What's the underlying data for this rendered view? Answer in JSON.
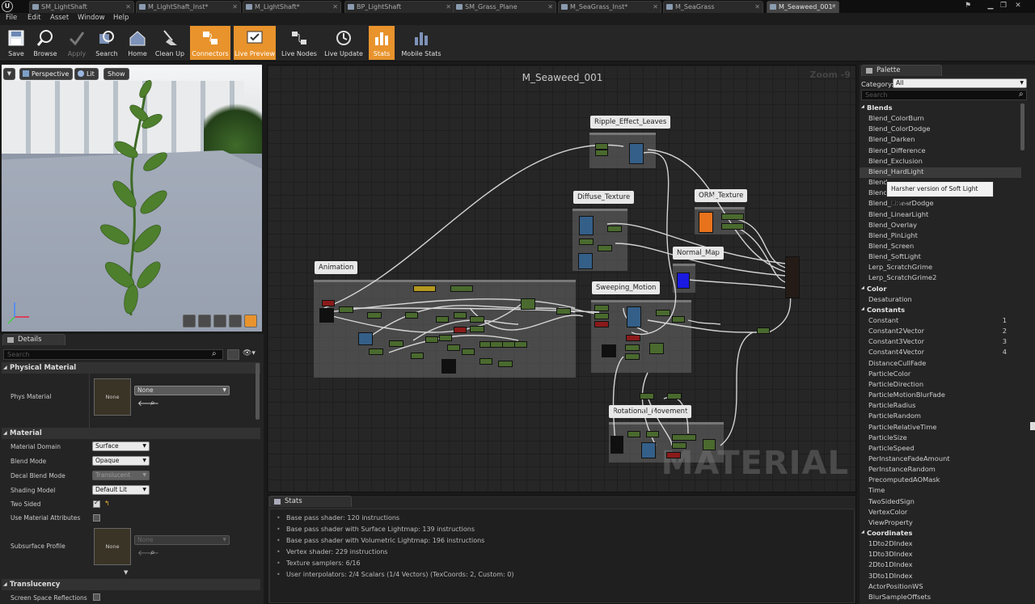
{
  "tabs": [
    {
      "label": "SM_LightShaft",
      "active": false
    },
    {
      "label": "M_LightShaft_Inst*",
      "active": false
    },
    {
      "label": "M_LightShaft*",
      "active": false
    },
    {
      "label": "BP_LightShaft",
      "active": false
    },
    {
      "label": "SM_Grass_Plane",
      "active": false
    },
    {
      "label": "M_SeaGrass_Inst*",
      "active": false
    },
    {
      "label": "M_SeaGrass",
      "active": false
    },
    {
      "label": "M_Seaweed_001*",
      "active": true
    }
  ],
  "menu": [
    "File",
    "Edit",
    "Asset",
    "Window",
    "Help"
  ],
  "toolbar": [
    {
      "label": "Save",
      "state": "normal",
      "icon": "save-icon"
    },
    {
      "label": "Browse",
      "state": "normal",
      "icon": "browse-icon"
    },
    {
      "label": "Apply",
      "state": "disabled",
      "icon": "apply-icon"
    },
    {
      "label": "Search",
      "state": "normal",
      "icon": "search-icon"
    },
    {
      "label": "Home",
      "state": "normal",
      "icon": "home-icon"
    },
    {
      "label": "Clean Up",
      "state": "normal",
      "icon": "clean-up-icon"
    },
    {
      "label": "Connectors",
      "state": "active",
      "icon": "connectors-icon"
    },
    {
      "label": "Live Preview",
      "state": "active",
      "icon": "live-preview-icon"
    },
    {
      "label": "Live Nodes",
      "state": "normal",
      "icon": "live-nodes-icon"
    },
    {
      "label": "Live Update",
      "state": "normal",
      "icon": "live-update-icon"
    },
    {
      "label": "Stats",
      "state": "active",
      "icon": "stats-icon"
    },
    {
      "label": "Mobile Stats",
      "state": "normal",
      "icon": "mobile-stats-icon"
    }
  ],
  "viewport": {
    "perspective": "Perspective",
    "lit": "Lit",
    "show": "Show"
  },
  "details": {
    "tab": "Details",
    "search_placeholder": "Search",
    "physical_material": {
      "header": "Physical Material",
      "phys_material_label": "Phys Material",
      "thumb_text": "None",
      "value": "None"
    },
    "material": {
      "header": "Material",
      "rows": [
        {
          "label": "Material Domain",
          "value": "Surface",
          "enabled": true
        },
        {
          "label": "Blend Mode",
          "value": "Opaque",
          "enabled": true
        },
        {
          "label": "Decal Blend Mode",
          "value": "Translucent",
          "enabled": false
        },
        {
          "label": "Shading Model",
          "value": "Default Lit",
          "enabled": true
        }
      ],
      "two_sided_label": "Two Sided",
      "two_sided": true,
      "use_attr_label": "Use Material Attributes",
      "use_attr": false,
      "subsurface_label": "Subsurface Profile",
      "subsurface_thumb": "None",
      "subsurface_value": "None"
    },
    "translucency": {
      "header": "Translucency",
      "ssr_label": "Screen Space Reflections"
    }
  },
  "graph": {
    "title": "M_Seaweed_001",
    "zoom": "Zoom -9",
    "watermark": "MATERIAL",
    "comments": [
      {
        "name": "Ripple_Effect_Leaves"
      },
      {
        "name": "Diffuse_Texture"
      },
      {
        "name": "ORM_Texture"
      },
      {
        "name": "Normal_Map"
      },
      {
        "name": "Animation"
      },
      {
        "name": "Sweeping_Motion"
      },
      {
        "name": "Rotational_Movement"
      }
    ]
  },
  "stats": {
    "tab": "Stats",
    "lines": [
      "Base pass shader: 120 instructions",
      "Base pass shader with Surface Lightmap: 139 instructions",
      "Base pass shader with Volumetric Lightmap: 196 instructions",
      "Vertex shader: 229 instructions",
      "Texture samplers: 6/16",
      "User interpolators: 2/4 Scalars (1/4 Vectors) (TexCoords: 2, Custom: 0)"
    ]
  },
  "palette": {
    "tab": "Palette",
    "category_label": "Category:",
    "category_value": "All",
    "search_placeholder": "Search",
    "tooltip": "Harsher version of Soft Light blend",
    "entries": [
      {
        "t": "cat",
        "label": "Blends"
      },
      {
        "t": "item",
        "label": "Blend_ColorBurn"
      },
      {
        "t": "item",
        "label": "Blend_ColorDodge"
      },
      {
        "t": "item",
        "label": "Blend_Darken"
      },
      {
        "t": "item",
        "label": "Blend_Difference"
      },
      {
        "t": "item",
        "label": "Blend_Exclusion"
      },
      {
        "t": "item",
        "label": "Blend_HardLight",
        "hover": true
      },
      {
        "t": "item",
        "label": "Blend"
      },
      {
        "t": "item",
        "label": "Blend"
      },
      {
        "t": "item",
        "label": "Blend_LinearDodge"
      },
      {
        "t": "item",
        "label": "Blend_LinearLight"
      },
      {
        "t": "item",
        "label": "Blend_Overlay"
      },
      {
        "t": "item",
        "label": "Blend_PinLight"
      },
      {
        "t": "item",
        "label": "Blend_Screen"
      },
      {
        "t": "item",
        "label": "Blend_SoftLight"
      },
      {
        "t": "item",
        "label": "Lerp_ScratchGrime"
      },
      {
        "t": "item",
        "label": "Lerp_ScratchGrime2"
      },
      {
        "t": "cat",
        "label": "Color"
      },
      {
        "t": "item",
        "label": "Desaturation"
      },
      {
        "t": "cat",
        "label": "Constants"
      },
      {
        "t": "item",
        "label": "Constant",
        "key": "1"
      },
      {
        "t": "item",
        "label": "Constant2Vector",
        "key": "2"
      },
      {
        "t": "item",
        "label": "Constant3Vector",
        "key": "3"
      },
      {
        "t": "item",
        "label": "Constant4Vector",
        "key": "4"
      },
      {
        "t": "item",
        "label": "DistanceCullFade"
      },
      {
        "t": "item",
        "label": "ParticleColor"
      },
      {
        "t": "item",
        "label": "ParticleDirection"
      },
      {
        "t": "item",
        "label": "ParticleMotionBlurFade"
      },
      {
        "t": "item",
        "label": "ParticleRadius"
      },
      {
        "t": "item",
        "label": "ParticleRandom"
      },
      {
        "t": "item",
        "label": "ParticleRelativeTime"
      },
      {
        "t": "item",
        "label": "ParticleSize"
      },
      {
        "t": "item",
        "label": "ParticleSpeed"
      },
      {
        "t": "item",
        "label": "PerInstanceFadeAmount"
      },
      {
        "t": "item",
        "label": "PerInstanceRandom"
      },
      {
        "t": "item",
        "label": "PrecomputedAOMask"
      },
      {
        "t": "item",
        "label": "Time"
      },
      {
        "t": "item",
        "label": "TwoSidedSign"
      },
      {
        "t": "item",
        "label": "VertexColor"
      },
      {
        "t": "item",
        "label": "ViewProperty"
      },
      {
        "t": "cat",
        "label": "Coordinates"
      },
      {
        "t": "item",
        "label": "1Dto2DIndex"
      },
      {
        "t": "item",
        "label": "1Dto3DIndex"
      },
      {
        "t": "item",
        "label": "2Dto1DIndex"
      },
      {
        "t": "item",
        "label": "3Dto1DIndex"
      },
      {
        "t": "item",
        "label": "ActorPositionWS"
      },
      {
        "t": "item",
        "label": "BlurSampleOffsets"
      }
    ]
  }
}
